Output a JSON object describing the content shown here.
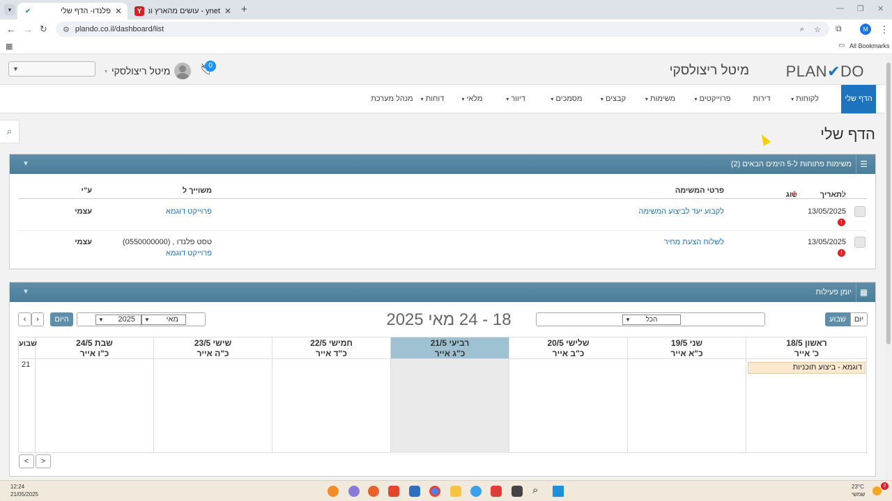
{
  "browser": {
    "tabs": [
      {
        "title": "פלנדו- הדף שלי",
        "active": true
      },
      {
        "title": "ynet - עושים מהארץ ומהעולם",
        "active": false
      }
    ],
    "new_tab": "+",
    "url": "plando.co.il/dashboard/list",
    "bookmarks_label": "All Bookmarks",
    "profile_initial": "M"
  },
  "header": {
    "logo_plan": "PLAN",
    "logo_do": "DO",
    "company": "מיטל ריצולסקי",
    "user_name": "מיטל ריצולסקי",
    "notif_count": "0"
  },
  "nav": {
    "items": [
      {
        "label": "הדף שלי"
      },
      {
        "label": "לקוחות"
      },
      {
        "label": "דירות"
      },
      {
        "label": "פרוייקטים"
      },
      {
        "label": "משימות"
      },
      {
        "label": "קבצים"
      },
      {
        "label": "מסמכים"
      },
      {
        "label": "דיוור"
      },
      {
        "label": "מלאי"
      },
      {
        "label": "דוחות"
      },
      {
        "label": "מנהל מערכת"
      }
    ]
  },
  "page_title": "הדף שלי",
  "tasks_panel": {
    "title": "משימות פתוחות ל-5 הימים הבאים (2)",
    "headers": {
      "date": "לתאריך",
      "type": "סוג",
      "details": "פרטי המשימה",
      "assigned": "משוייך ל",
      "by": "ע\"י"
    },
    "rows": [
      {
        "date": "13/05/2025",
        "details": "לקבוע יעד לביצוע המשימה",
        "assigned_1": "פרוייקט דוגמא",
        "assigned_2": "",
        "by": "עצמי"
      },
      {
        "date": "13/05/2025",
        "details": "לשלוח הצעת מחיר",
        "assigned_1": "טסט פלנדו , (0550000000)",
        "assigned_2": "פרוייקט דוגמא",
        "by": "עצמי"
      }
    ]
  },
  "calendar_panel": {
    "title": "יומן פעילות",
    "view_day": "יום",
    "view_week": "שבוע",
    "filter_value": "הכל",
    "range_title": "18 - 24 מאי 2025",
    "month": "מאי",
    "year": "2025",
    "today_btn": "היום",
    "week_label": "שבוע",
    "week_number": "21",
    "days": [
      {
        "name": "ראשון 18/5",
        "hebrew": "כ' אייר"
      },
      {
        "name": "שני 19/5",
        "hebrew": "כ\"א אייר"
      },
      {
        "name": "שלישי 20/5",
        "hebrew": "כ\"ב אייר"
      },
      {
        "name": "רביעי 21/5",
        "hebrew": "כ\"ג אייר"
      },
      {
        "name": "חמישי 22/5",
        "hebrew": "כ\"ד אייר"
      },
      {
        "name": "שישי 23/5",
        "hebrew": "כ\"ה אייר"
      },
      {
        "name": "שבת 24/5",
        "hebrew": "כ\"ו אייר"
      }
    ],
    "event": "דוגמא - ביצוע תוכניות"
  },
  "taskbar": {
    "time": "12:24",
    "date": "21/05/2025",
    "temp": "23°C",
    "weather": "שמשי",
    "notif": "2"
  },
  "colors": {
    "brand": "#1e73be",
    "panel_header": "#4a7d99",
    "today": "#9fc2d2"
  }
}
